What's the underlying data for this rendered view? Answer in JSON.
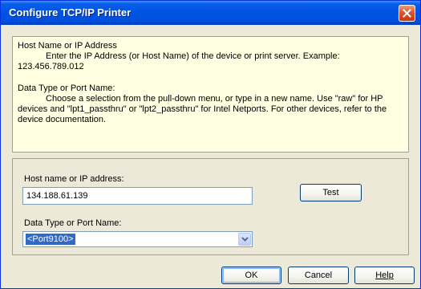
{
  "window": {
    "title": "Configure TCP/IP Printer"
  },
  "info": {
    "host_heading": "Host Name or IP Address",
    "host_text_indent": "Enter the IP Address (or Host Name) of the device or print server.  Example:",
    "host_text_example": "123.456.789.012",
    "port_heading": "Data Type or Port Name:",
    "port_text": "Choose a selection from the pull-down menu, or type in a new name.  Use \"raw\" for HP devices and \"lpt1_passthru\" or \"lpt2_passthru\" for Intel Netports.  For other devices, refer to the device documentation."
  },
  "form": {
    "host_label": "Host name or IP address:",
    "host_value": "134.188.61.139",
    "port_label": "Data Type or Port Name:",
    "port_value": "<Port9100>"
  },
  "buttons": {
    "test": "Test",
    "ok": "OK",
    "cancel": "Cancel",
    "help": "Help"
  },
  "icons": {
    "close": "close-icon",
    "dropdown": "chevron-down-icon"
  },
  "colors": {
    "titlebar": "#0054e3",
    "info_background": "#ffffe1",
    "dialog_background": "#ece9d8",
    "selection": "#316ac5"
  }
}
